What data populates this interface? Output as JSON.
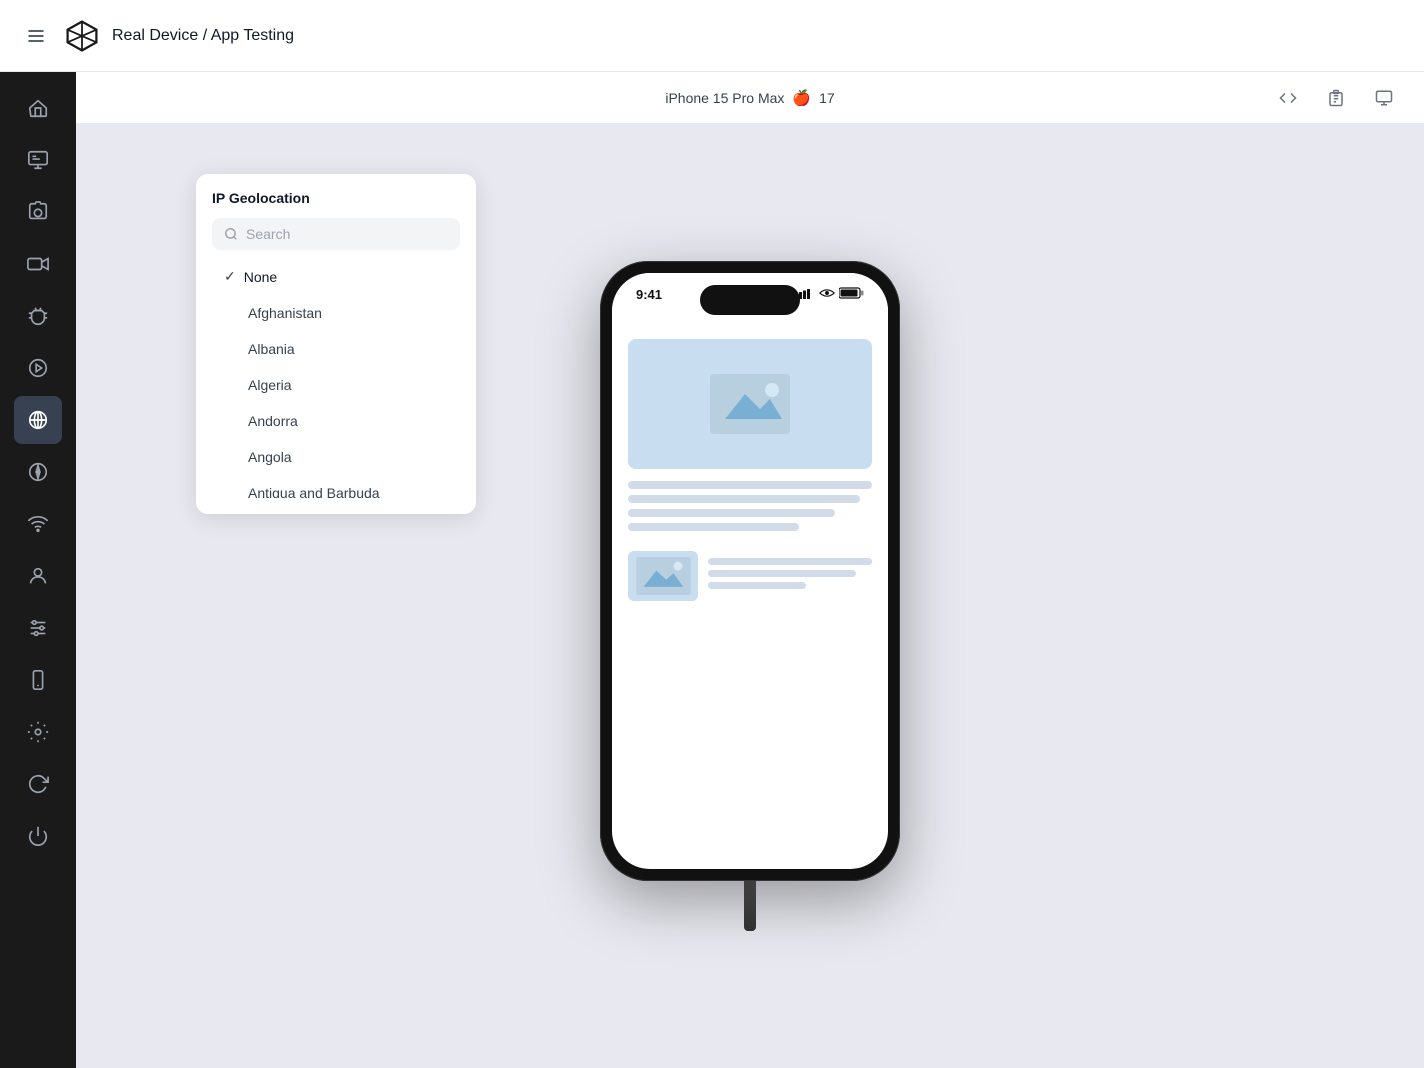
{
  "topbar": {
    "title": "Real Device / App Testing",
    "menu_label": "Menu"
  },
  "device_header": {
    "device_name": "iPhone 15 Pro Max",
    "ios_icon": "",
    "ios_version": "17",
    "actions": {
      "code": "</>",
      "clipboard": "📋",
      "settings": "⚙"
    }
  },
  "sidebar": {
    "items": [
      {
        "id": "home",
        "label": "Home"
      },
      {
        "id": "inspector",
        "label": "Inspector"
      },
      {
        "id": "screenshot",
        "label": "Screenshot"
      },
      {
        "id": "video",
        "label": "Video"
      },
      {
        "id": "debug",
        "label": "Debug"
      },
      {
        "id": "media",
        "label": "Media"
      },
      {
        "id": "geolocation",
        "label": "Geolocation"
      },
      {
        "id": "compass",
        "label": "Compass"
      },
      {
        "id": "network",
        "label": "Network"
      },
      {
        "id": "profile",
        "label": "Profile"
      },
      {
        "id": "sliders",
        "label": "Sliders"
      },
      {
        "id": "device-info",
        "label": "Device Info"
      },
      {
        "id": "settings",
        "label": "Settings"
      },
      {
        "id": "refresh",
        "label": "Refresh"
      },
      {
        "id": "power",
        "label": "Power"
      }
    ]
  },
  "geo_panel": {
    "title": "IP Geolocation",
    "search_placeholder": "Search",
    "countries": [
      {
        "id": "none",
        "label": "None",
        "selected": true
      },
      {
        "id": "afghanistan",
        "label": "Afghanistan"
      },
      {
        "id": "albania",
        "label": "Albania"
      },
      {
        "id": "algeria",
        "label": "Algeria"
      },
      {
        "id": "andorra",
        "label": "Andorra"
      },
      {
        "id": "angola",
        "label": "Angola"
      },
      {
        "id": "antigua",
        "label": "Antigua and Barbuda"
      }
    ]
  },
  "phone": {
    "time": "9:41",
    "status_icons": "▌▌▌ ◀ ▊"
  }
}
